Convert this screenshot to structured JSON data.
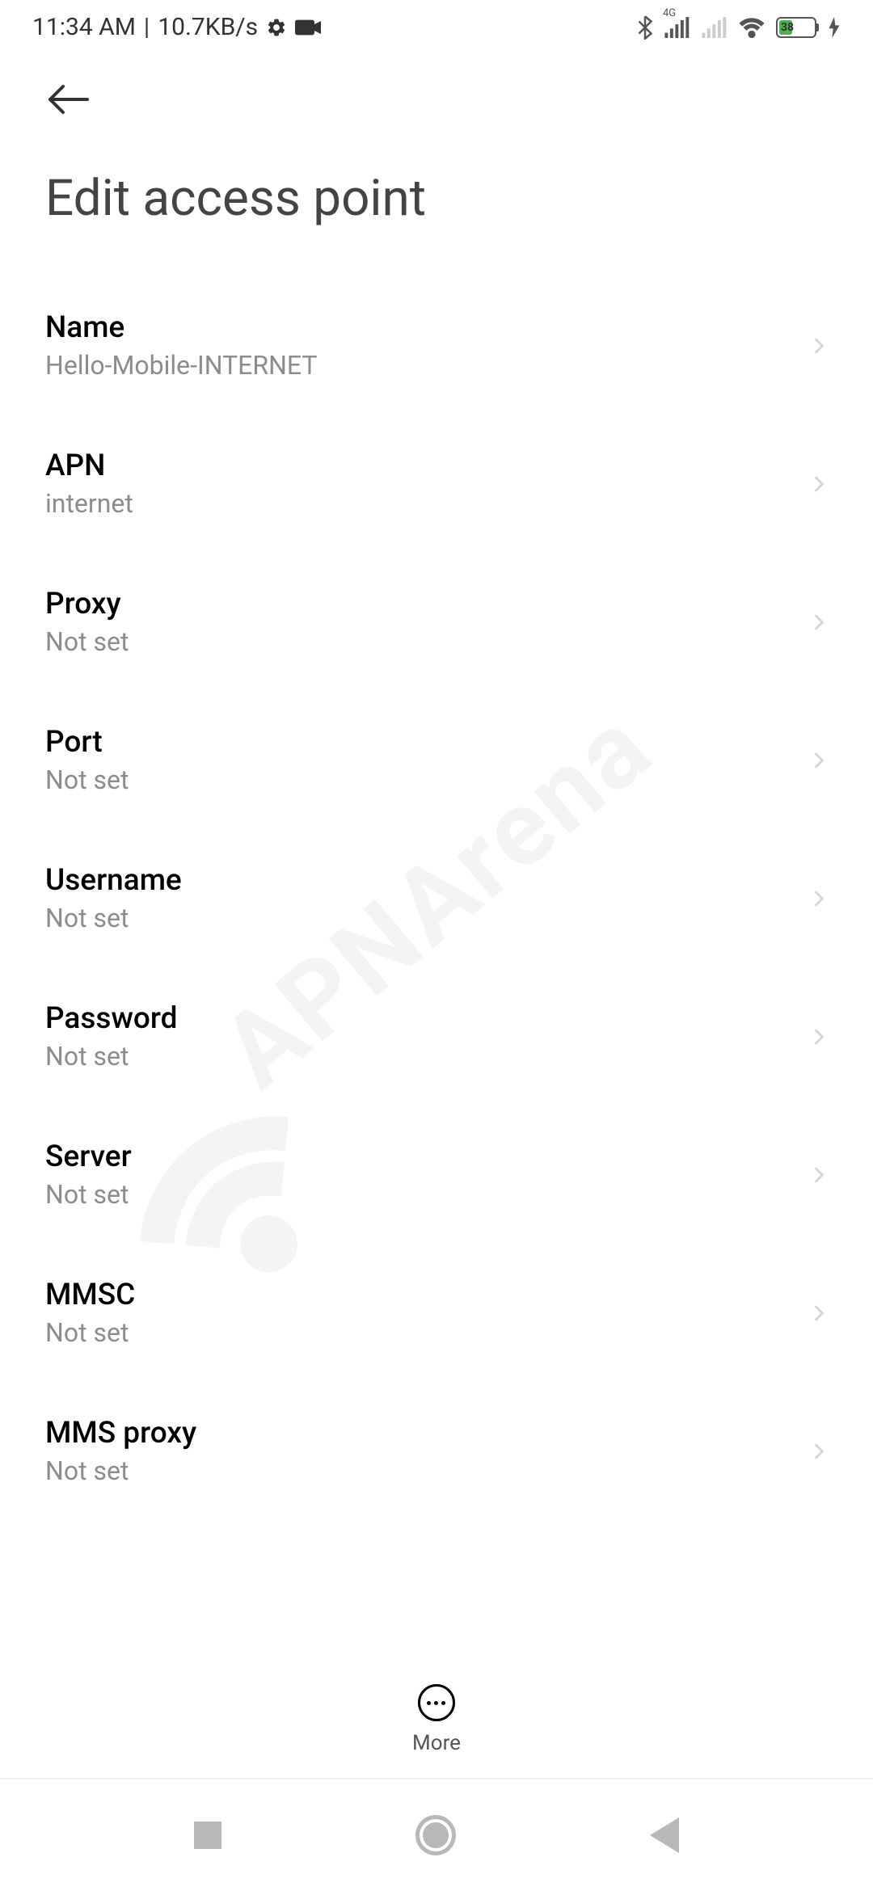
{
  "status": {
    "time": "11:34 AM",
    "divider": "|",
    "speed": "10.7KB/s",
    "battery": "38",
    "network": "4G"
  },
  "title": "Edit access point",
  "items": [
    {
      "label": "Name",
      "value": "Hello-Mobile-INTERNET"
    },
    {
      "label": "APN",
      "value": "internet"
    },
    {
      "label": "Proxy",
      "value": "Not set"
    },
    {
      "label": "Port",
      "value": "Not set"
    },
    {
      "label": "Username",
      "value": "Not set"
    },
    {
      "label": "Password",
      "value": "Not set"
    },
    {
      "label": "Server",
      "value": "Not set"
    },
    {
      "label": "MMSC",
      "value": "Not set"
    },
    {
      "label": "MMS proxy",
      "value": "Not set"
    }
  ],
  "more": "More",
  "watermark": "APNArena"
}
